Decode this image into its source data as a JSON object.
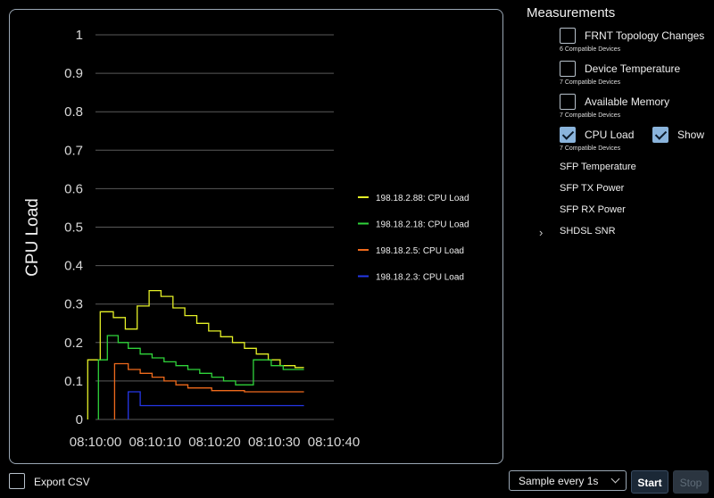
{
  "chart_data": {
    "type": "line",
    "ylabel": "CPU Load",
    "ylim": [
      0,
      1
    ],
    "yticks": [
      "0",
      "0.1",
      "0.2",
      "0.3",
      "0.4",
      "0.5",
      "0.6",
      "0.7",
      "0.8",
      "0.9",
      "1"
    ],
    "x_ticks": [
      "08:10:00",
      "08:10:10",
      "08:10:20",
      "08:10:30",
      "08:10:40"
    ],
    "x_domain": [
      0,
      40
    ],
    "series": [
      {
        "name": "198.18.2.88: CPU Load",
        "color": "#e4f027",
        "points": [
          [
            -1.3,
            0
          ],
          [
            -1.3,
            0.155
          ],
          [
            0.8,
            0.155
          ],
          [
            0.8,
            0.28
          ],
          [
            3,
            0.28
          ],
          [
            3,
            0.265
          ],
          [
            5,
            0.265
          ],
          [
            5,
            0.235
          ],
          [
            7,
            0.235
          ],
          [
            7,
            0.295
          ],
          [
            9,
            0.295
          ],
          [
            9,
            0.335
          ],
          [
            11,
            0.335
          ],
          [
            11,
            0.32
          ],
          [
            13,
            0.32
          ],
          [
            13,
            0.29
          ],
          [
            15,
            0.29
          ],
          [
            15,
            0.27
          ],
          [
            17,
            0.27
          ],
          [
            17,
            0.25
          ],
          [
            19,
            0.25
          ],
          [
            19,
            0.23
          ],
          [
            21,
            0.23
          ],
          [
            21,
            0.215
          ],
          [
            23,
            0.215
          ],
          [
            23,
            0.2
          ],
          [
            25,
            0.2
          ],
          [
            25,
            0.185
          ],
          [
            27,
            0.185
          ],
          [
            27,
            0.17
          ],
          [
            29,
            0.17
          ],
          [
            29,
            0.155
          ],
          [
            31,
            0.155
          ],
          [
            31,
            0.14
          ],
          [
            33.5,
            0.14
          ],
          [
            33.5,
            0.135
          ],
          [
            35,
            0.135
          ]
        ]
      },
      {
        "name": "198.18.2.18: CPU Load",
        "color": "#2fd33a",
        "points": [
          [
            0.5,
            0
          ],
          [
            0.5,
            0.155
          ],
          [
            2,
            0.155
          ],
          [
            2,
            0.218
          ],
          [
            3.8,
            0.218
          ],
          [
            3.8,
            0.2
          ],
          [
            5.5,
            0.2
          ],
          [
            5.5,
            0.185
          ],
          [
            7.5,
            0.185
          ],
          [
            7.5,
            0.17
          ],
          [
            9.5,
            0.17
          ],
          [
            9.5,
            0.16
          ],
          [
            11.5,
            0.16
          ],
          [
            11.5,
            0.15
          ],
          [
            13.5,
            0.15
          ],
          [
            13.5,
            0.14
          ],
          [
            15.5,
            0.14
          ],
          [
            15.5,
            0.13
          ],
          [
            17.5,
            0.13
          ],
          [
            17.5,
            0.12
          ],
          [
            19.5,
            0.12
          ],
          [
            19.5,
            0.11
          ],
          [
            21.5,
            0.11
          ],
          [
            21.5,
            0.1
          ],
          [
            23.5,
            0.1
          ],
          [
            23.5,
            0.09
          ],
          [
            26.5,
            0.09
          ],
          [
            26.5,
            0.155
          ],
          [
            29.5,
            0.155
          ],
          [
            29.5,
            0.14
          ],
          [
            31.5,
            0.14
          ],
          [
            31.5,
            0.13
          ],
          [
            35,
            0.13
          ]
        ]
      },
      {
        "name": "198.18.2.5: CPU Load",
        "color": "#ef6a1c",
        "points": [
          [
            3.2,
            0
          ],
          [
            3.2,
            0.145
          ],
          [
            5.5,
            0.145
          ],
          [
            5.5,
            0.13
          ],
          [
            7.5,
            0.13
          ],
          [
            7.5,
            0.12
          ],
          [
            9.5,
            0.12
          ],
          [
            9.5,
            0.11
          ],
          [
            11.5,
            0.11
          ],
          [
            11.5,
            0.1
          ],
          [
            13.5,
            0.1
          ],
          [
            13.5,
            0.09
          ],
          [
            15.5,
            0.09
          ],
          [
            15.5,
            0.082
          ],
          [
            19.5,
            0.082
          ],
          [
            19.5,
            0.075
          ],
          [
            25,
            0.075
          ],
          [
            25,
            0.072
          ],
          [
            35,
            0.072
          ]
        ]
      },
      {
        "name": "198.18.2.3: CPU Load",
        "color": "#2537e8",
        "points": [
          [
            5.5,
            0
          ],
          [
            5.5,
            0.072
          ],
          [
            7.5,
            0.072
          ],
          [
            7.5,
            0.036
          ],
          [
            35,
            0.036
          ]
        ]
      }
    ]
  },
  "sidebar": {
    "title": "Measurements",
    "items": [
      {
        "label": "FRNT Topology Changes",
        "sub": "6 Compatible Devices",
        "checked": false
      },
      {
        "label": "Device Temperature",
        "sub": "7 Compatible Devices",
        "checked": false
      },
      {
        "label": "Available Memory",
        "sub": "7 Compatible Devices",
        "checked": false
      },
      {
        "label": "CPU Load",
        "sub": "7 Compatible Devices",
        "checked": true
      }
    ],
    "show_label": "Show",
    "plain_items": [
      "SFP Temperature",
      "SFP TX Power",
      "SFP RX Power"
    ],
    "group_item": "SHDSL SNR"
  },
  "footer": {
    "export_label": "Export CSV",
    "sample_select": "Sample every 1s",
    "start_label": "Start",
    "stop_label": "Stop"
  }
}
